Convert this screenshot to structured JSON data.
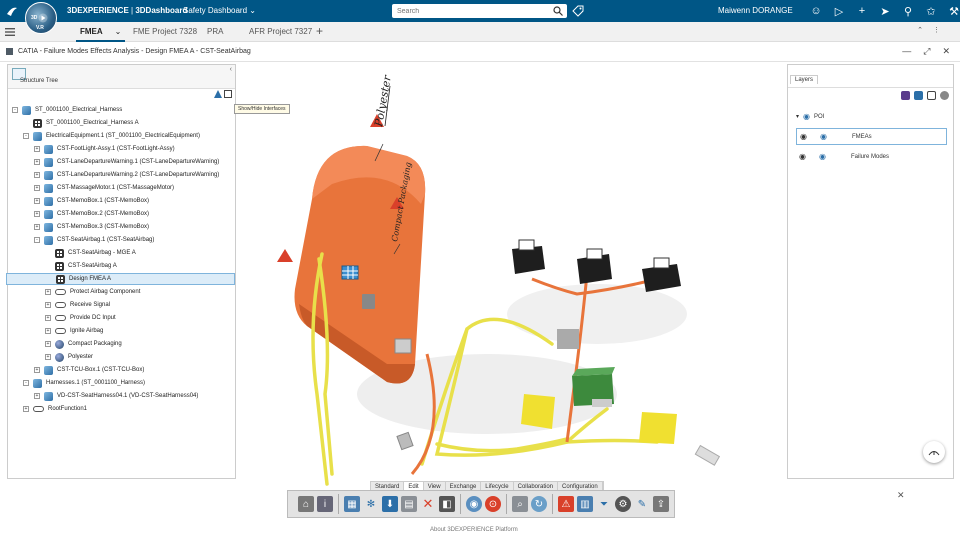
{
  "topbar": {
    "brand_left": "3DEXPERIENCE",
    "brand_right": "3DDashboard",
    "dashboard": "Safety Dashboard",
    "search_placeholder": "Search",
    "user": "Maiwenn DORANGE",
    "compass_labels": [
      "3D",
      "V.R"
    ],
    "icons": [
      "user-icon",
      "tag-icon",
      "plus-icon",
      "share-icon",
      "network-icon",
      "like-icon",
      "tools-icon"
    ]
  },
  "tabs": [
    {
      "label": "FMEA",
      "active": true
    },
    {
      "label": "FME Project 7328",
      "active": false
    },
    {
      "label": "PRA",
      "active": false
    },
    {
      "label": "AFR Project 7327",
      "active": false
    }
  ],
  "title": "CATIA - Failure Modes Effects Analysis - Design FMEA A - CST-SeatAirbag",
  "tree": {
    "header": "Structure Tree",
    "tooltip": "Show/Hide Interfaces",
    "rows": [
      {
        "label": "ST_0001100_Electrical_Harness",
        "indent": 0,
        "exp": "-",
        "icon": "prod"
      },
      {
        "label": "ST_0001100_Electrical_Harness A",
        "indent": 1,
        "exp": "",
        "icon": "table"
      },
      {
        "label": "ElectricalEquipment.1 (ST_0001100_ElectricalEquipment)",
        "indent": 1,
        "exp": "-",
        "icon": "prod"
      },
      {
        "label": "CST-FootLight-Assy.1 (CST-FootLight-Assy)",
        "indent": 2,
        "exp": "+",
        "icon": "prod"
      },
      {
        "label": "CST-LaneDepartureWarning.1 (CST-LaneDepartureWarning)",
        "indent": 2,
        "exp": "+",
        "icon": "prod"
      },
      {
        "label": "CST-LaneDepartureWarning.2 (CST-LaneDepartureWarning)",
        "indent": 2,
        "exp": "+",
        "icon": "prod"
      },
      {
        "label": "CST-MassageMotor.1 (CST-MassageMotor)",
        "indent": 2,
        "exp": "+",
        "icon": "prod"
      },
      {
        "label": "CST-MemoBox.1 (CST-MemoBox)",
        "indent": 2,
        "exp": "+",
        "icon": "prod"
      },
      {
        "label": "CST-MemoBox.2 (CST-MemoBox)",
        "indent": 2,
        "exp": "+",
        "icon": "prod"
      },
      {
        "label": "CST-MemoBox.3 (CST-MemoBox)",
        "indent": 2,
        "exp": "+",
        "icon": "prod"
      },
      {
        "label": "CST-SeatAirbag.1 (CST-SeatAirbag)",
        "indent": 2,
        "exp": "-",
        "icon": "prod"
      },
      {
        "label": "CST-SeatAirbag - MGE A",
        "indent": 3,
        "exp": "",
        "icon": "table"
      },
      {
        "label": "CST-SeatAirbag A",
        "indent": 3,
        "exp": "",
        "icon": "table"
      },
      {
        "label": "Design FMEA A",
        "indent": 3,
        "exp": "",
        "icon": "table",
        "selected": true
      },
      {
        "label": "Protect Airbag Component",
        "indent": 3,
        "exp": "+",
        "icon": "func"
      },
      {
        "label": "Receive Signal",
        "indent": 3,
        "exp": "+",
        "icon": "func"
      },
      {
        "label": "Provide DC Input",
        "indent": 3,
        "exp": "+",
        "icon": "func"
      },
      {
        "label": "Ignite Airbag",
        "indent": 3,
        "exp": "+",
        "icon": "func"
      },
      {
        "label": "Compact Packaging",
        "indent": 3,
        "exp": "+",
        "icon": "ball"
      },
      {
        "label": "Polyester",
        "indent": 3,
        "exp": "+",
        "icon": "ball"
      },
      {
        "label": "CST-TCU-Box.1 (CST-TCU-Box)",
        "indent": 2,
        "exp": "+",
        "icon": "prod"
      },
      {
        "label": "Harnesses.1 (ST_0001100_Harness)",
        "indent": 1,
        "exp": "-",
        "icon": "prod"
      },
      {
        "label": "VD-CST-SeatHarness04.1 (VD-CST-SeatHarness04)",
        "indent": 2,
        "exp": "+",
        "icon": "prod"
      },
      {
        "label": "RootFunction1",
        "indent": 1,
        "exp": "+",
        "icon": "func"
      }
    ]
  },
  "layers": {
    "tab": "Layers",
    "group": "POI",
    "items": [
      {
        "label": "FMEAs",
        "selected": true
      },
      {
        "label": "Failure Modes",
        "selected": false
      }
    ]
  },
  "viewport": {
    "annotations": [
      "Polyester",
      "Compact Packaging"
    ]
  },
  "toolbar": {
    "tabs": [
      "Standard",
      "Edit",
      "View",
      "Exchange",
      "Lifecycle",
      "Collaboration",
      "Configuration"
    ],
    "active_tab": "Edit"
  },
  "footer": "About 3DEXPERIENCE Platform",
  "colors": {
    "brand": "#005686",
    "airbag": "#e8743b",
    "harness_yellow": "#e8e04a",
    "harness_orange": "#e8743b",
    "box_green": "#3d8a3d",
    "box_yellow": "#f0e030"
  }
}
